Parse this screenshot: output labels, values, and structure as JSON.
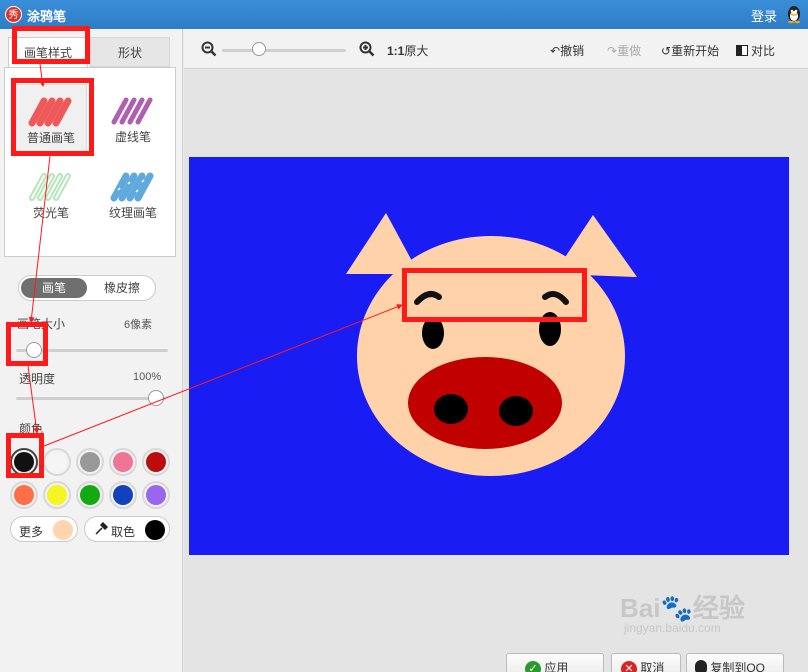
{
  "window": {
    "title": "涂鸦笔",
    "app_icon_text": "秀",
    "login": "登录"
  },
  "tabs": {
    "brush_style": "画笔样式",
    "shape": "形状"
  },
  "brush_styles": [
    {
      "label": "普通画笔",
      "color": "#ee5a5a"
    },
    {
      "label": "虚线笔",
      "color": "#b05fb0"
    },
    {
      "label": "荧光笔",
      "color": "#9fe0a6"
    },
    {
      "label": "纹理画笔",
      "color": "#5fa9dd"
    }
  ],
  "mode": {
    "brush": "画笔",
    "eraser": "橡皮擦"
  },
  "brush_size": {
    "label": "画笔大小",
    "value": "6像素"
  },
  "opacity": {
    "label": "透明度",
    "value": "100%"
  },
  "color_label": "颜色",
  "palette": [
    "#111111",
    "#f5f5f5",
    "#999999",
    "#f07595",
    "#bb0d0d",
    "#ff6f47",
    "#f5f521",
    "#11aa11",
    "#1142bb",
    "#9966ee"
  ],
  "more_colors": {
    "label": "更多",
    "color": "#ffd5b0"
  },
  "pick_color": {
    "label": "取色",
    "color": "#000000"
  },
  "toolbar": {
    "zoom_ratio": "1:1",
    "original_size": "原大",
    "undo": "撤销",
    "redo": "重做",
    "restart": "重新开始",
    "compare": "对比"
  },
  "actions": {
    "apply": "应用",
    "cancel": "取消",
    "copy_to_qq": "复制到QQ"
  },
  "watermark": {
    "brand": "Bai",
    "brand2": "经验",
    "url": "jingyan.baidu.com"
  },
  "colors": {
    "canvas_bg": "#1a1cf4",
    "pig_skin": "#ffd2aa",
    "pig_snout": "#c10000",
    "highlight": "#ff1a1a"
  }
}
